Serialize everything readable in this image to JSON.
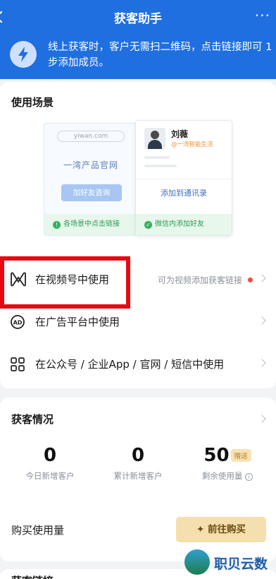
{
  "header": {
    "title": "获客助手",
    "more": "···",
    "intro": "线上获客时，客户无需扫二维码，点击链接即可 1 步添加成员。",
    "bg_color": "#1f6fe0"
  },
  "scenes": {
    "title": "使用场景",
    "illustration": {
      "url": "yiwan.com",
      "site_name": "一湾产品官网",
      "add_friend_button": "加好友咨询",
      "tip_left": "各场景中点击链接",
      "contact_name": "刘薇",
      "contact_company": "@一湾智能生活",
      "add_to_contacts": "添加到通讯录",
      "tip_right": "微信内添加好友"
    },
    "rows": [
      {
        "label": "在视频号中使用",
        "hint": "可为视频添加获客链接",
        "icon": "video-channel-icon"
      },
      {
        "label": "在广告平台中使用",
        "hint": "",
        "icon": "ad-icon"
      },
      {
        "label": "在公众号 / 企业App / 官网 / 短信中使用",
        "hint": "",
        "icon": "apps-grid-icon"
      }
    ]
  },
  "acquisition": {
    "title": "获客情况",
    "stats": [
      {
        "value": "0",
        "label": "今日新增客户"
      },
      {
        "value": "0",
        "label": "累计新增客户"
      },
      {
        "value": "50",
        "label": "剩余使用量",
        "badge": "赠送"
      }
    ],
    "buy_label": "购买使用量",
    "buy_button": "前往购买"
  },
  "links_section": {
    "title": "获客链接"
  },
  "watermark": {
    "text": "职贝云数"
  },
  "colors": {
    "accent": "#1f6fe0",
    "highlight": "#e50912",
    "buy": "#f6dfae",
    "success": "#2c9a55"
  }
}
